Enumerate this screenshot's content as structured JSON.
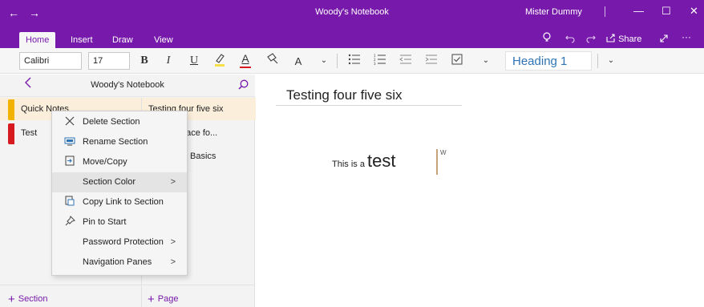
{
  "titlebar": {
    "back_icon": "←",
    "forward_icon": "→",
    "title": "Woody's Notebook",
    "user": "Mister Dummy",
    "minimize_icon": "—",
    "maximize_icon": "☐",
    "close_icon": "✕"
  },
  "tabs": [
    {
      "label": "Home"
    },
    {
      "label": "Insert"
    },
    {
      "label": "Draw"
    },
    {
      "label": "View"
    }
  ],
  "tabs_right": {
    "share_label": "Share",
    "more_icon": "···"
  },
  "ribbon": {
    "font_name": "Calibri",
    "font_size": "17",
    "bold": "B",
    "italic": "I",
    "underline": "U",
    "font_color": "A",
    "clear_format": "A",
    "style_name": "Heading 1"
  },
  "sidebar": {
    "notebook_title": "Woody's Notebook",
    "sections": [
      {
        "label": "Quick Notes",
        "color": "#f2b200"
      },
      {
        "label": "Test",
        "color": "#d71920"
      }
    ],
    "pages": [
      {
        "label": "Testing four five six"
      },
      {
        "label": "…: one place fo..."
      },
      {
        "label": "Basics"
      }
    ],
    "add_section": "Section",
    "add_page": "Page"
  },
  "context_menu": {
    "items": [
      {
        "label": "Delete Section",
        "icon": "close-icon",
        "glyph": "✕"
      },
      {
        "label": "Rename Section",
        "icon": "rename-icon",
        "glyph": "▭"
      },
      {
        "label": "Move/Copy",
        "icon": "move-copy-icon",
        "glyph": "⇥"
      },
      {
        "label": "Section Color",
        "icon": "",
        "glyph": "",
        "submenu": true
      },
      {
        "label": "Copy Link to Section",
        "icon": "copy-link-icon",
        "glyph": "⧉"
      },
      {
        "label": "Pin to Start",
        "icon": "pin-icon",
        "glyph": "✎"
      },
      {
        "label": "Password Protection",
        "icon": "",
        "glyph": "",
        "submenu": true
      },
      {
        "label": "Navigation Panes",
        "icon": "",
        "glyph": "",
        "submenu": true
      }
    ],
    "submenu_arrow": ">"
  },
  "page": {
    "title": "Testing four five six",
    "text_small": "This is a",
    "text_big": "test",
    "cursor_label": "W"
  },
  "colors": {
    "accent": "#7719aa",
    "heading": "#2e74b5",
    "selection": "#fbefdb"
  }
}
